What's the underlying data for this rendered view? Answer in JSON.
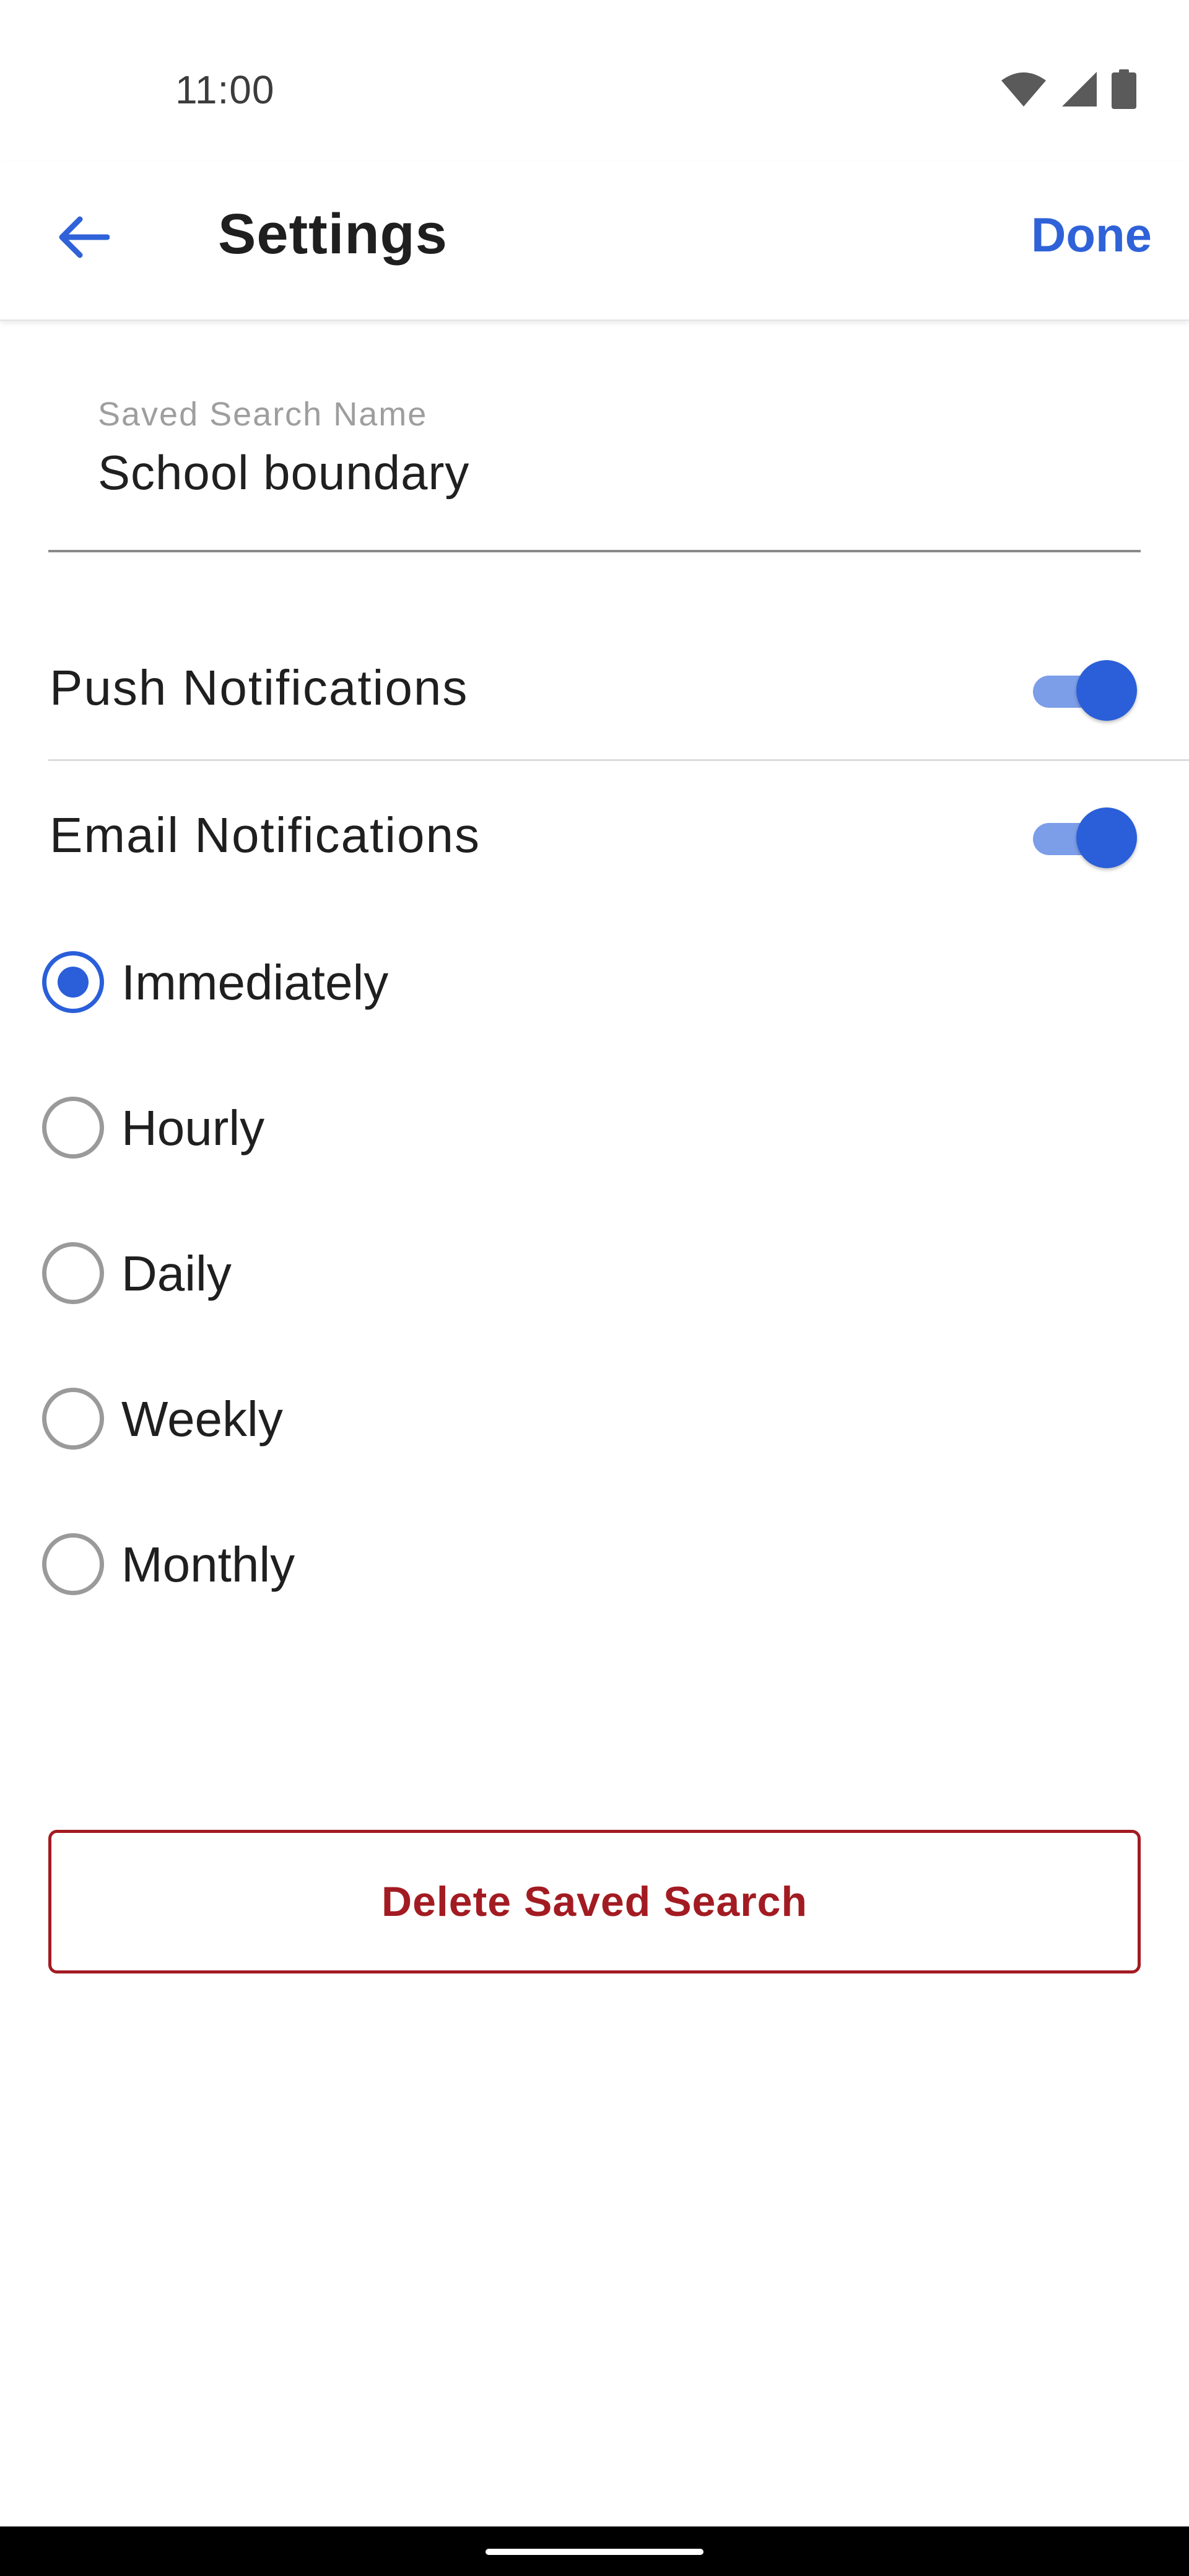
{
  "status_bar": {
    "time": "11:00",
    "icons": [
      "wifi-icon",
      "cell-signal-icon",
      "battery-icon"
    ]
  },
  "app_bar": {
    "back_icon": "arrow-left-icon",
    "title": "Settings",
    "done_label": "Done"
  },
  "saved_search": {
    "label": "Saved Search Name",
    "value": "School boundary"
  },
  "push_notifications": {
    "label": "Push Notifications",
    "enabled": true
  },
  "email_notifications": {
    "label": "Email Notifications",
    "enabled": true
  },
  "frequency": {
    "selected": "Immediately",
    "options": [
      "Immediately",
      "Hourly",
      "Daily",
      "Weekly",
      "Monthly"
    ]
  },
  "delete_label": "Delete Saved Search",
  "colors": {
    "accent": "#2a5fd9",
    "done_text": "#2f62d8",
    "danger": "#a31b22",
    "switch_track": "#7c9ee9"
  }
}
